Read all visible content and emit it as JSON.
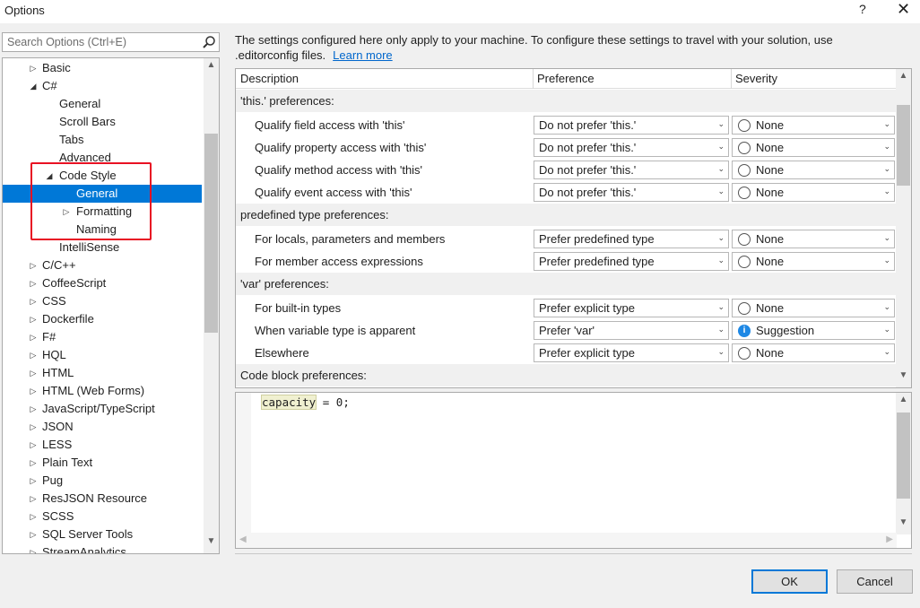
{
  "window": {
    "title": "Options",
    "help": "?",
    "close": "✕"
  },
  "search": {
    "placeholder": "Search Options (Ctrl+E)"
  },
  "tree": [
    {
      "label": "Basic",
      "level": 1,
      "arrow": "▷"
    },
    {
      "label": "C#",
      "level": 1,
      "arrow": "◢"
    },
    {
      "label": "General",
      "level": 2,
      "arrow": ""
    },
    {
      "label": "Scroll Bars",
      "level": 2,
      "arrow": ""
    },
    {
      "label": "Tabs",
      "level": 2,
      "arrow": ""
    },
    {
      "label": "Advanced",
      "level": 2,
      "arrow": ""
    },
    {
      "label": "Code Style",
      "level": 2,
      "arrow": "◢"
    },
    {
      "label": "General",
      "level": 3,
      "arrow": "",
      "selected": true
    },
    {
      "label": "Formatting",
      "level": 3,
      "arrow": "▷"
    },
    {
      "label": "Naming",
      "level": 3,
      "arrow": ""
    },
    {
      "label": "IntelliSense",
      "level": 2,
      "arrow": ""
    },
    {
      "label": "C/C++",
      "level": 1,
      "arrow": "▷"
    },
    {
      "label": "CoffeeScript",
      "level": 1,
      "arrow": "▷"
    },
    {
      "label": "CSS",
      "level": 1,
      "arrow": "▷"
    },
    {
      "label": "Dockerfile",
      "level": 1,
      "arrow": "▷"
    },
    {
      "label": "F#",
      "level": 1,
      "arrow": "▷"
    },
    {
      "label": "HQL",
      "level": 1,
      "arrow": "▷"
    },
    {
      "label": "HTML",
      "level": 1,
      "arrow": "▷"
    },
    {
      "label": "HTML (Web Forms)",
      "level": 1,
      "arrow": "▷"
    },
    {
      "label": "JavaScript/TypeScript",
      "level": 1,
      "arrow": "▷"
    },
    {
      "label": "JSON",
      "level": 1,
      "arrow": "▷"
    },
    {
      "label": "LESS",
      "level": 1,
      "arrow": "▷"
    },
    {
      "label": "Plain Text",
      "level": 1,
      "arrow": "▷"
    },
    {
      "label": "Pug",
      "level": 1,
      "arrow": "▷"
    },
    {
      "label": "ResJSON Resource",
      "level": 1,
      "arrow": "▷"
    },
    {
      "label": "SCSS",
      "level": 1,
      "arrow": "▷"
    },
    {
      "label": "SQL Server Tools",
      "level": 1,
      "arrow": "▷"
    },
    {
      "label": "StreamAnalytics",
      "level": 1,
      "arrow": "▷"
    }
  ],
  "info": {
    "text": "The settings configured here only apply to your machine. To configure these settings to travel with your solution, use .editorconfig files.",
    "link": "Learn more"
  },
  "grid": {
    "headers": {
      "description": "Description",
      "preference": "Preference",
      "severity": "Severity"
    },
    "rows": [
      {
        "type": "section",
        "label": "'this.' preferences:"
      },
      {
        "type": "option",
        "label": "Qualify field access with 'this'",
        "preference": "Do not prefer 'this.'",
        "severity": "None",
        "severity_icon": "radio-empty-icon"
      },
      {
        "type": "option",
        "label": "Qualify property access with 'this'",
        "preference": "Do not prefer 'this.'",
        "severity": "None",
        "severity_icon": "radio-empty-icon"
      },
      {
        "type": "option",
        "label": "Qualify method access with 'this'",
        "preference": "Do not prefer 'this.'",
        "severity": "None",
        "severity_icon": "radio-empty-icon"
      },
      {
        "type": "option",
        "label": "Qualify event access with 'this'",
        "preference": "Do not prefer 'this.'",
        "severity": "None",
        "severity_icon": "radio-empty-icon"
      },
      {
        "type": "section",
        "label": "predefined type preferences:"
      },
      {
        "type": "option",
        "label": "For locals, parameters and members",
        "preference": "Prefer predefined type",
        "severity": "None",
        "severity_icon": "radio-empty-icon"
      },
      {
        "type": "option",
        "label": "For member access expressions",
        "preference": "Prefer predefined type",
        "severity": "None",
        "severity_icon": "radio-empty-icon"
      },
      {
        "type": "section",
        "label": "'var' preferences:"
      },
      {
        "type": "option",
        "label": "For built-in types",
        "preference": "Prefer explicit type",
        "severity": "None",
        "severity_icon": "radio-empty-icon"
      },
      {
        "type": "option",
        "label": "When variable type is apparent",
        "preference": "Prefer 'var'",
        "severity": "Suggestion",
        "severity_icon": "info-icon"
      },
      {
        "type": "option",
        "label": "Elsewhere",
        "preference": "Prefer explicit type",
        "severity": "None",
        "severity_icon": "radio-empty-icon"
      },
      {
        "type": "section",
        "label": "Code block preferences:"
      }
    ]
  },
  "code_preview": {
    "highlight": "capacity",
    "rest": " = 0;"
  },
  "buttons": {
    "ok": "OK",
    "cancel": "Cancel"
  },
  "colors": {
    "selection": "#0078d7",
    "annotation_box": "#e81123",
    "link": "#0066cc"
  }
}
